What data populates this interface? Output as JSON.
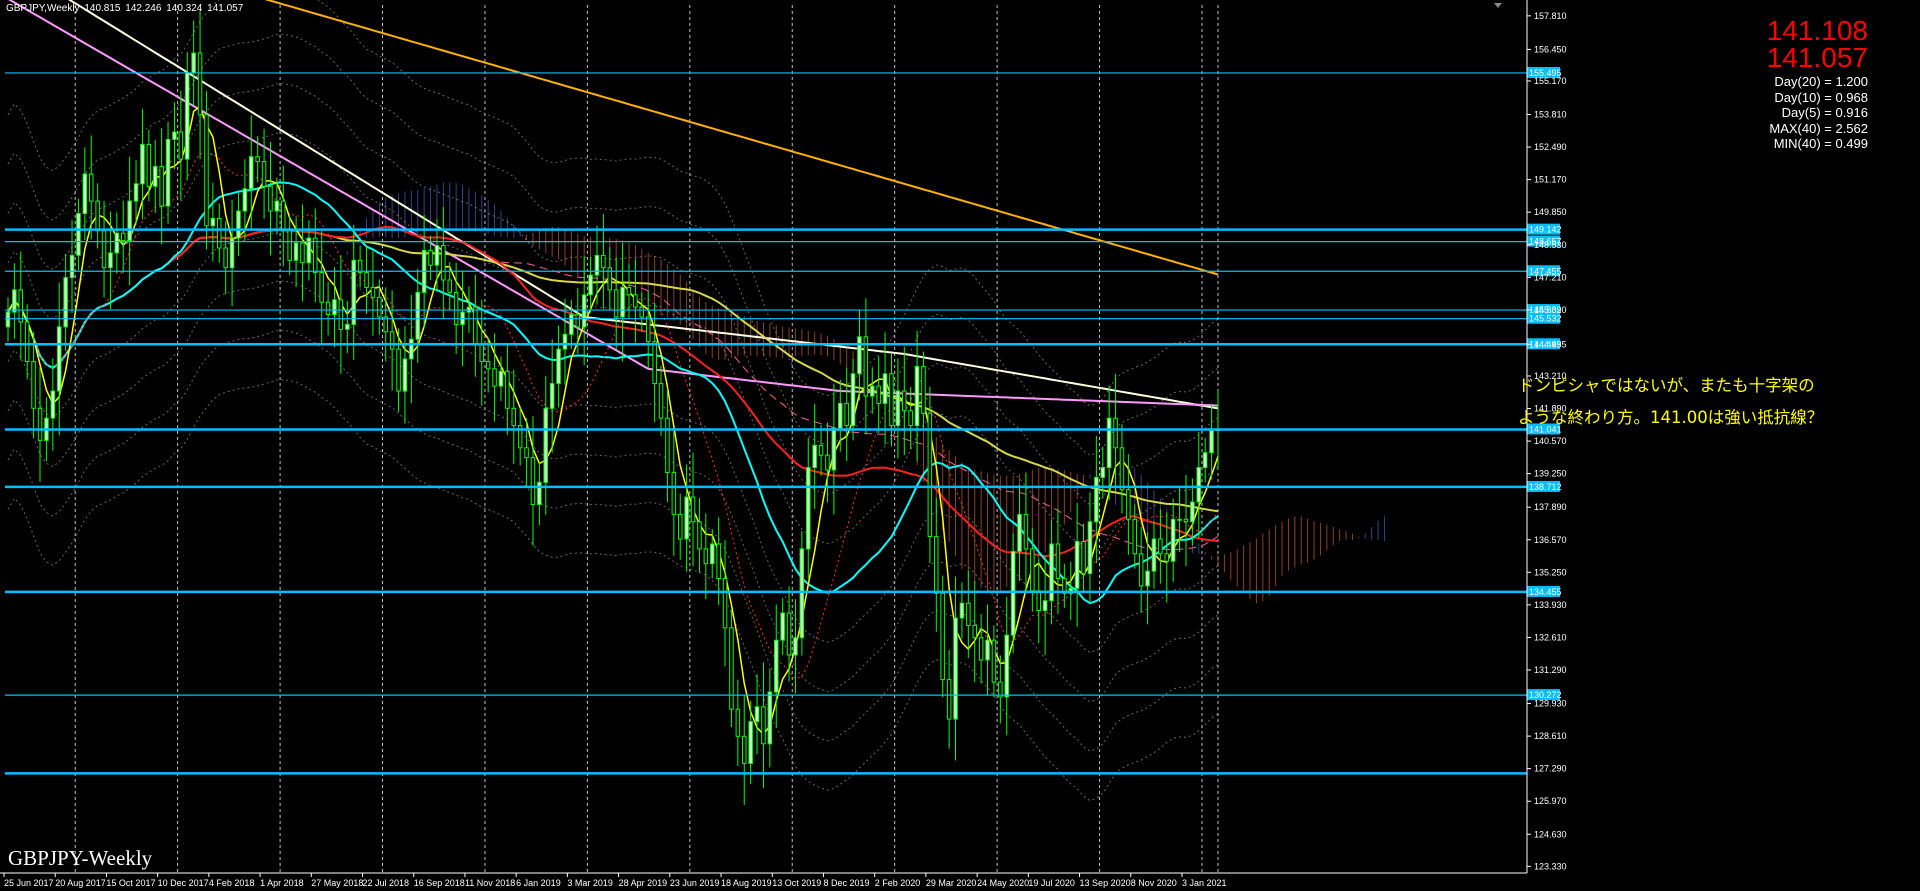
{
  "window": {
    "symbol": "GBPJPY,Weekly",
    "ohlc": [
      "140.815",
      "142.246",
      "140.324",
      "141.057"
    ]
  },
  "price_box": {
    "bid": "141.108",
    "ask": "141.057"
  },
  "stats": [
    "Day(20) = 1.200",
    "Day(10) = 0.968",
    "Day(5) = 0.916",
    "MAX(40) = 2.562",
    "MIN(40) = 0.499"
  ],
  "annotation": {
    "line1": "ドンピシャではないが、またも十字架の",
    "line2": "ような終わり方。141.00は強い抵抗線？"
  },
  "watermark": "GBPJPY-Weekly",
  "colors": {
    "background": "#000000",
    "bull_candle": "#ccffcc",
    "candle_wick": "#00ff00",
    "horizontal_line": "#00bfff",
    "price_label_bg": "#00bfff",
    "ma_yellow": "#ffff00",
    "ma_cyan": "#00ffff",
    "ma_red": "#ff2020",
    "ma_olive": "#d8d84a",
    "ma_pink": "#ff99ff",
    "ma_cream": "#ffffe0",
    "ma_orange": "#ffb000",
    "cloud_bull": "#7070ff",
    "cloud_bear": "#ff7a4a",
    "text": "#ffffff"
  },
  "chart_data": {
    "type": "candlestick",
    "title": "GBPJPY,Weekly",
    "ylim": [
      123.06,
      158.25
    ],
    "y_tick_labels": [
      "157.810",
      "156.450",
      "155.170",
      "153.810",
      "152.490",
      "151.170",
      "149.850",
      "148.530",
      "147.210",
      "145.890",
      "144.495",
      "143.210",
      "141.890",
      "140.570",
      "139.250",
      "137.890",
      "136.570",
      "135.250",
      "133.930",
      "132.610",
      "131.290",
      "129.930",
      "128.610",
      "127.290",
      "125.970",
      "124.630",
      "123.330"
    ],
    "x_tick_labels": [
      "25 Jun 2017",
      "20 Aug 2017",
      "15 Oct 2017",
      "10 Dec 2017",
      "4 Feb 2018",
      "1 Apr 2018",
      "27 May 2018",
      "22 Jul 2018",
      "16 Sep 2018",
      "11 Nov 2018",
      "6 Jan 2019",
      "3 Mar 2019",
      "28 Apr 2019",
      "23 Jun 2019",
      "18 Aug 2019",
      "13 Oct 2019",
      "8 Dec 2019",
      "2 Feb 2020",
      "29 Mar 2020",
      "24 May 2020",
      "19 Jul 2020",
      "13 Sep 2020",
      "8 Nov 2020",
      "3 Jan 2021"
    ],
    "horizontal_levels": [
      {
        "value": 155.495,
        "label": "155.495",
        "weight": "thin"
      },
      {
        "value": 149.142,
        "label": "149.142",
        "weight": "thick"
      },
      {
        "value": 148.657,
        "label": "148.657",
        "weight": "thin"
      },
      {
        "value": 147.455,
        "label": "147.455",
        "weight": "thin"
      },
      {
        "value": 145.882,
        "label": "145.882",
        "weight": "thin"
      },
      {
        "value": 145.532,
        "label": "145.532",
        "weight": "thin"
      },
      {
        "value": 144.495,
        "label": "144.495",
        "weight": "thick"
      },
      {
        "value": 141.041,
        "label": "141.041",
        "weight": "thick"
      },
      {
        "value": 138.712,
        "label": "138.712",
        "weight": "thick"
      },
      {
        "value": 134.455,
        "label": "134.455",
        "weight": "thick"
      },
      {
        "value": 130.272,
        "label": "130.272",
        "weight": "thin"
      },
      {
        "value": 127.1,
        "label": "",
        "weight": "thick"
      }
    ],
    "current_price": 141.057,
    "closes": [
      145.8,
      146.7,
      145.4,
      143.8,
      141.9,
      140.6,
      141.5,
      142.6,
      145.2,
      147.2,
      148.1,
      149.8,
      151.4,
      150.3,
      149.1,
      147.6,
      148.2,
      149.0,
      148.7,
      150.3,
      151.0,
      152.6,
      150.9,
      151.7,
      150.1,
      152.8,
      153.1,
      152.0,
      155.5,
      156.3,
      153.8,
      149.3,
      149.6,
      148.4,
      147.6,
      148.8,
      149.9,
      150.8,
      152.1,
      151.9,
      150.9,
      149.9,
      150.3,
      149.1,
      147.9,
      148.6,
      147.8,
      148.8,
      147.4,
      146.2,
      145.7,
      146.3,
      145.1,
      145.3,
      147.9,
      147.4,
      146.8,
      146.4,
      145.6,
      145.0,
      144.3,
      142.6,
      143.9,
      144.7,
      146.6,
      148.3,
      147.7,
      148.5,
      147.1,
      146.6,
      145.3,
      145.8,
      146.0,
      144.5,
      143.8,
      143.5,
      142.8,
      143.4,
      141.9,
      141.2,
      140.3,
      139.9,
      138.0,
      138.9,
      141.9,
      142.9,
      144.3,
      144.9,
      145.7,
      145.2,
      146.5,
      147.3,
      148.1,
      147.6,
      146.7,
      145.6,
      146.8,
      146.5,
      146.0,
      145.6,
      144.6,
      142.9,
      141.5,
      139.3,
      137.6,
      136.6,
      138.3,
      137.3,
      136.2,
      135.6,
      136.4,
      135.0,
      133.0,
      129.7,
      128.6,
      127.5,
      129.2,
      129.8,
      128.3,
      130.4,
      132.5,
      133.6,
      131.9,
      132.6,
      136.2,
      139.5,
      140.4,
      140.0,
      139.4,
      141.1,
      142.1,
      141.2,
      143.3,
      144.8,
      142.4,
      142.8,
      142.1,
      143.3,
      141.2,
      142.6,
      141.8,
      141.2,
      143.6,
      141.7,
      136.7,
      134.4,
      130.9,
      129.3,
      133.4,
      134.0,
      133.1,
      132.6,
      131.7,
      132.5,
      130.8,
      130.2,
      132.7,
      136.1,
      137.6,
      136.2,
      134.5,
      133.7,
      134.1,
      136.4,
      135.0,
      134.4,
      134.6,
      136.5,
      135.2,
      137.3,
      139.1,
      139.5,
      141.5,
      140.3,
      138.6,
      137.4,
      136.0,
      134.7,
      135.3,
      136.6,
      136.0,
      135.7,
      137.4,
      137.4,
      137.3,
      138.1,
      139.5,
      140.1,
      141.0,
      141.057
    ],
    "series": [
      {
        "name": "",
        "color": "#ffff00",
        "type": "moving-average"
      },
      {
        "name": "",
        "color": "#00ffff",
        "type": "moving-average"
      },
      {
        "name": "",
        "color": "#ff2020",
        "type": "moving-average"
      },
      {
        "name": "",
        "color": "#d8d84a",
        "type": "moving-average"
      },
      {
        "name": "",
        "color": "#ff99ff",
        "type": "moving-average"
      },
      {
        "name": "",
        "color": "#ffffe0",
        "type": "moving-average"
      },
      {
        "name": "",
        "color": "#ffb000",
        "type": "moving-average"
      }
    ],
    "grid": true
  }
}
